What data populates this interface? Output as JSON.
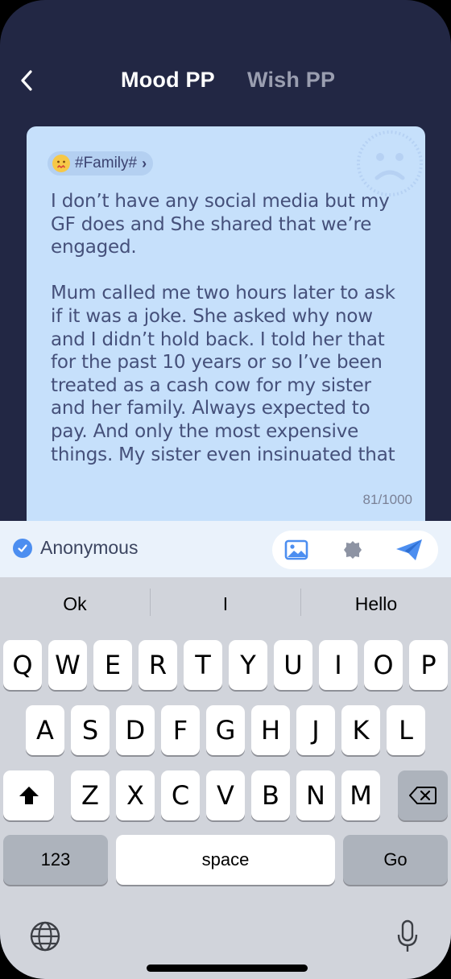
{
  "header": {
    "tabs": [
      {
        "label": "Mood PP",
        "active": true
      },
      {
        "label": "Wish PP",
        "active": false
      }
    ]
  },
  "card": {
    "tag": "#Family#",
    "text": "I don’t have any social media but my\nGF does and She shared that we’re\nengaged.\n\nMum called me two hours later to ask\nif it was a joke. She asked why now\nand I didn’t hold back. I told her that\nfor the past 10 years or so I’ve been\ntreated as a cash cow for my sister\nand her family. Always expected to\npay. And only the most expensive\nthings. My sister even insinuated that",
    "counter": "81/1000"
  },
  "bottom_bar": {
    "anonymous_label": "Anonymous",
    "anonymous_checked": true
  },
  "keyboard": {
    "suggestions": [
      "Ok",
      "I",
      "Hello"
    ],
    "row1": [
      "Q",
      "W",
      "E",
      "R",
      "T",
      "Y",
      "U",
      "I",
      "O",
      "P"
    ],
    "row2": [
      "A",
      "S",
      "D",
      "F",
      "G",
      "H",
      "J",
      "K",
      "L"
    ],
    "row3": [
      "Z",
      "X",
      "C",
      "V",
      "B",
      "N",
      "M"
    ],
    "numbers_label": "123",
    "space_label": "space",
    "go_label": "Go"
  },
  "colors": {
    "background": "#222744",
    "card": "#c6e0fb",
    "accent": "#4c8ef0"
  }
}
